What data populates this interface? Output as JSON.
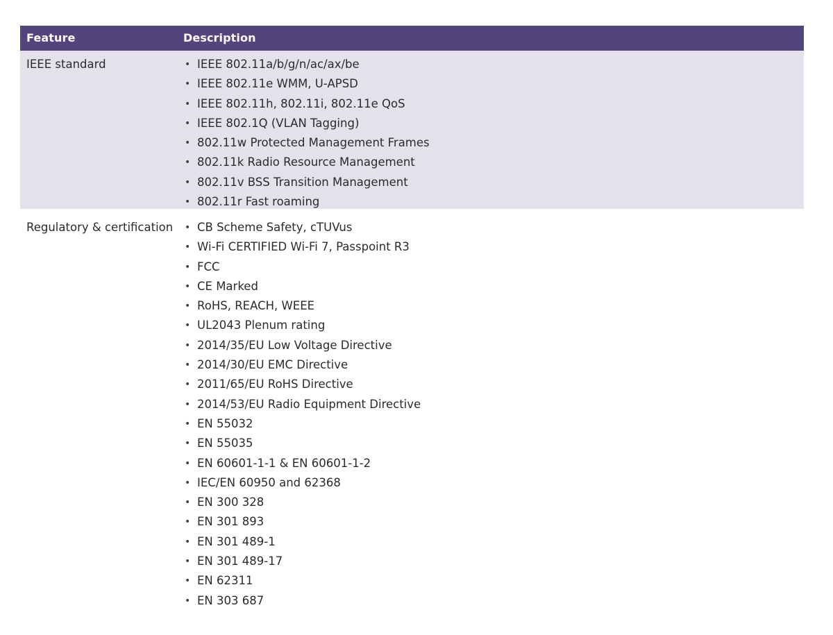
{
  "colors": {
    "header_bg": "#54447e",
    "shaded_row_bg": "#e4e1ea",
    "text": "#2b2b2b"
  },
  "table": {
    "headers": {
      "feature": "Feature",
      "description": "Description"
    },
    "rows": [
      {
        "feature": "IEEE standard",
        "items": [
          "IEEE 802.11a/b/g/n/ac/ax/be",
          "IEEE 802.11e WMM, U-APSD",
          "IEEE 802.11h, 802.11i, 802.11e QoS",
          "IEEE 802.1Q (VLAN Tagging)",
          "802.11w Protected Management Frames",
          "802.11k Radio Resource Management",
          "802.11v BSS Transition Management",
          "802.11r Fast roaming"
        ]
      },
      {
        "feature": "Regulatory & certification",
        "items": [
          "CB Scheme Safety, cTUVus",
          "Wi-Fi CERTIFIED Wi-Fi 7, Passpoint R3",
          "FCC",
          "CE Marked",
          "RoHS, REACH, WEEE",
          "UL2043 Plenum rating",
          "2014/35/EU Low Voltage Directive",
          "2014/30/EU EMC Directive",
          "2011/65/EU RoHS Directive",
          "2014/53/EU Radio Equipment Directive",
          "EN 55032",
          "EN 55035",
          "EN 60601-1-1 & EN 60601-1-2",
          "IEC/EN 60950 and 62368",
          "EN 300 328",
          "EN 301 893",
          "EN 301 489-1",
          "EN 301 489-17",
          "EN 62311",
          "EN 303 687"
        ]
      }
    ]
  }
}
